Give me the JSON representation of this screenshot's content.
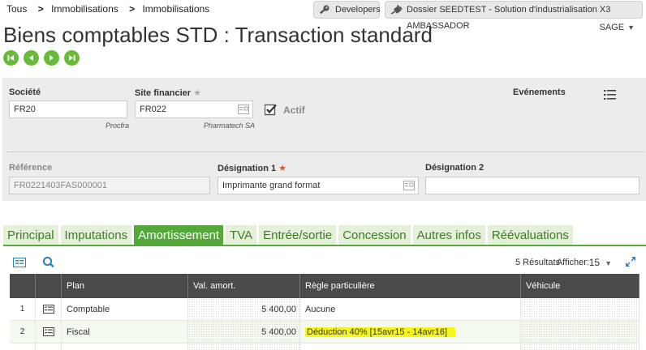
{
  "breadcrumb": [
    "Tous",
    "Immobilisations",
    "Immobilisations"
  ],
  "top_buttons": {
    "developers": "Developers",
    "dossier": "Dossier SEEDTEST - Solution d'industrialisation X3 AMBASSADOR"
  },
  "page_title": "Biens comptables STD : Transaction standard",
  "user_menu": "SAGE",
  "header": {
    "societe": {
      "label": "Société",
      "value": "FR20",
      "subtitle": "Procfra"
    },
    "site_financier": {
      "label": "Site financier",
      "value": "FR022",
      "subtitle": "Pharmatech SA"
    },
    "actif": {
      "label": "Actif",
      "checked": true
    },
    "evenements": {
      "label": "Evénements"
    },
    "reference": {
      "label": "Référence",
      "value": "FR0221403FAS000001"
    },
    "designation1": {
      "label": "Désignation 1",
      "value": "Imprimante grand format"
    },
    "designation2": {
      "label": "Désignation 2",
      "value": ""
    }
  },
  "tabs": [
    {
      "label": "Principal",
      "active": false
    },
    {
      "label": "Imputations",
      "active": false
    },
    {
      "label": "Amortissement",
      "active": true
    },
    {
      "label": "TVA",
      "active": false
    },
    {
      "label": "Entrée/sortie",
      "active": false
    },
    {
      "label": "Concession",
      "active": false
    },
    {
      "label": "Autres infos",
      "active": false
    },
    {
      "label": "Réévaluations",
      "active": false
    }
  ],
  "grid": {
    "results": "5 Résultats",
    "per_page_label": "Afficher:",
    "per_page": "15",
    "columns": [
      "Plan",
      "Val. amort.",
      "Règle particulière",
      "Véhicule"
    ],
    "rows": [
      {
        "num": "1",
        "plan": "Comptable",
        "val": "5 400,00",
        "regle": "Aucune",
        "vehicule": ""
      },
      {
        "num": "2",
        "plan": "Fiscal",
        "val": "5 400,00",
        "regle": "Déduction 40% [15avr15 - 14avr16]",
        "vehicule": ""
      }
    ]
  },
  "colors": {
    "accent_green": "#55a83a",
    "tab_inactive_bg": "#e4f1d8",
    "nav_green": "#6aba3a",
    "header_dark": "#4a4a4a",
    "highlight": "#f5f51a",
    "required_star": "#e0522a"
  }
}
